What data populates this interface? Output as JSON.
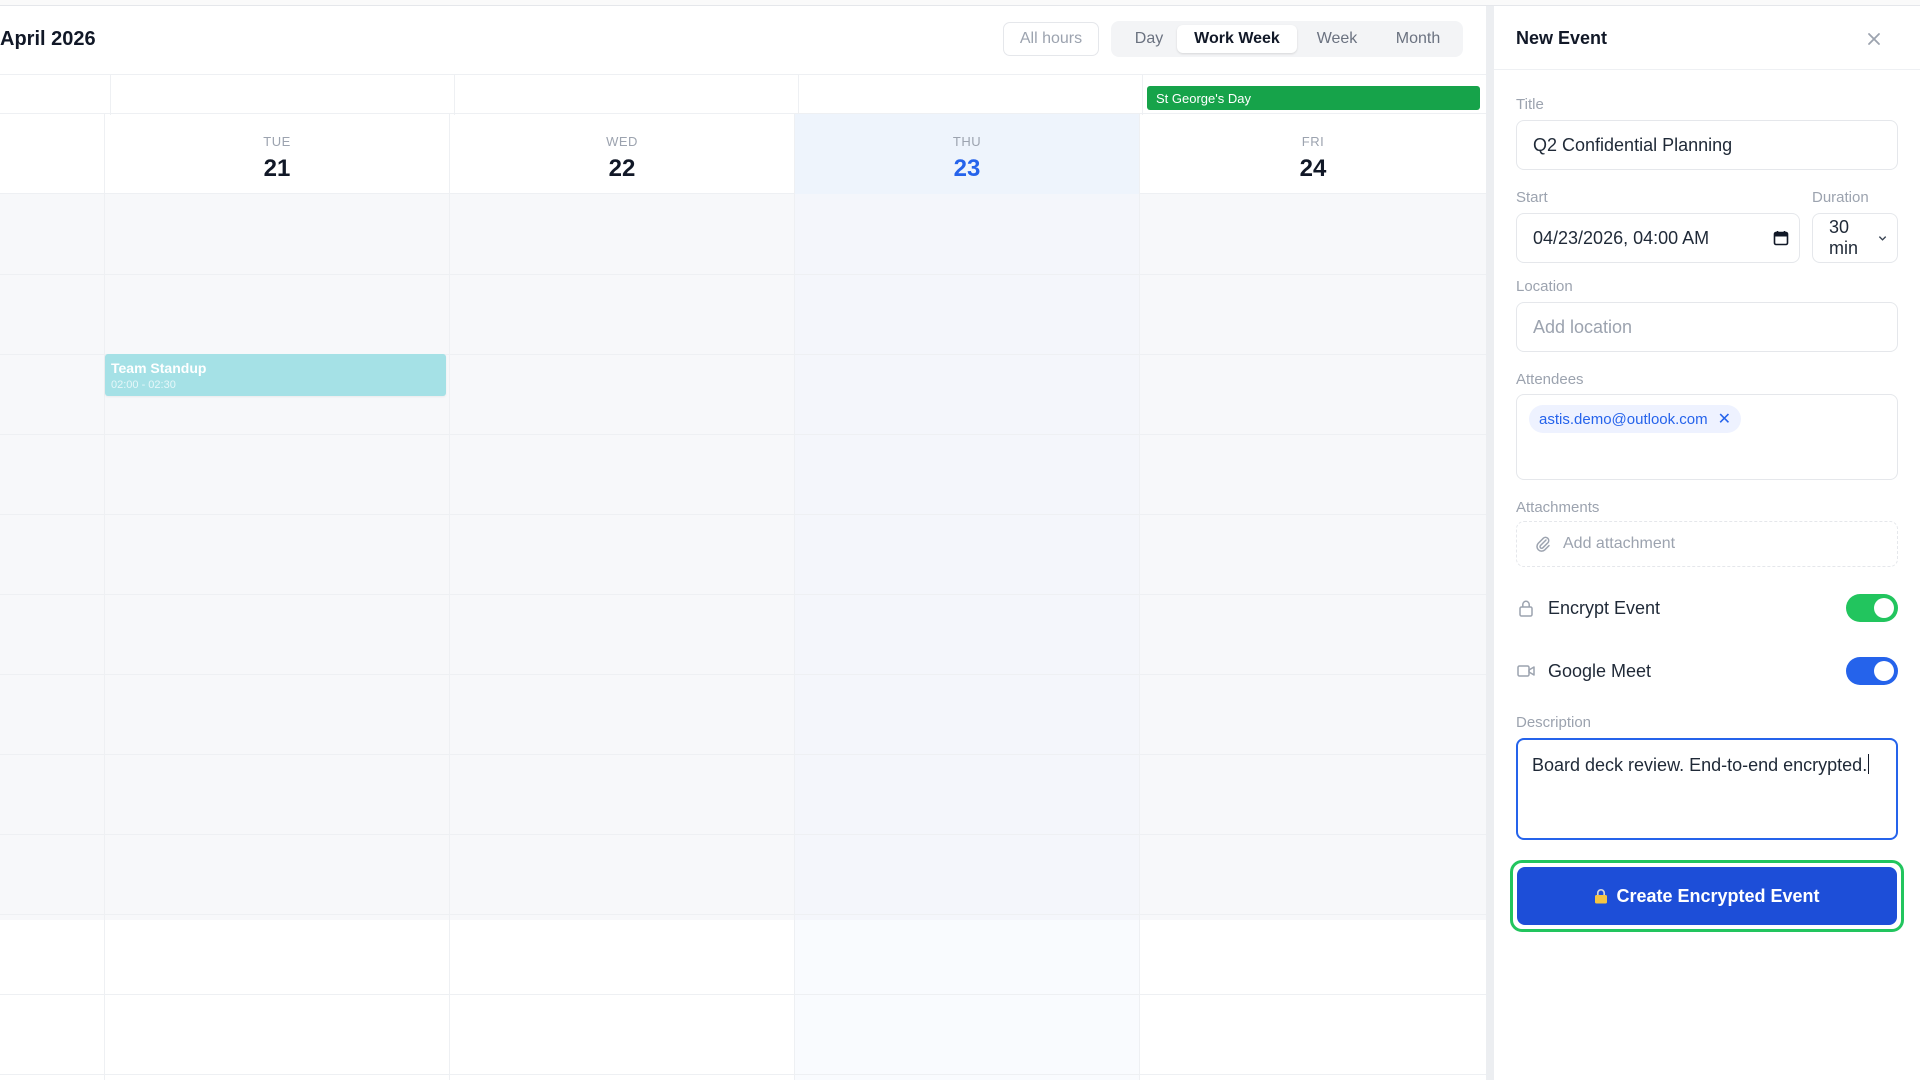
{
  "calendar": {
    "title": "April 2026",
    "all_hours_label": "All hours",
    "views": [
      "Day",
      "Work Week",
      "Week",
      "Month"
    ],
    "active_view": "Work Week",
    "holiday": "St George's Day",
    "days": [
      {
        "dow": "TUE",
        "num": "21"
      },
      {
        "dow": "WED",
        "num": "22"
      },
      {
        "dow": "THU",
        "num": "23",
        "today": true
      },
      {
        "dow": "FRI",
        "num": "24"
      }
    ],
    "event": {
      "title": "Team Standup",
      "time": "02:00 - 02:30",
      "color": "#a5e1e6"
    }
  },
  "panel": {
    "title": "New Event",
    "title_label": "Title",
    "title_value": "Q2 Confidential Planning",
    "start_label": "Start",
    "start_value": "04/23/2026, 04:00 AM",
    "duration_label": "Duration",
    "duration_value": "30 min",
    "location_label": "Location",
    "location_placeholder": "Add location",
    "attendees_label": "Attendees",
    "attendee": "astis.demo@outlook.com",
    "attachments_label": "Attachments",
    "attachment_placeholder": "Add attachment",
    "encrypt_label": "Encrypt Event",
    "encrypt_on": true,
    "meet_label": "Google Meet",
    "meet_on": true,
    "description_label": "Description",
    "description_value": "Board deck review. End-to-end encrypted.",
    "create_label": "Create Encrypted Event"
  },
  "colors": {
    "accent": "#2563eb",
    "encrypt_toggle": "#22c55e",
    "meet_toggle": "#2563eb",
    "holiday": "#16a34a"
  }
}
